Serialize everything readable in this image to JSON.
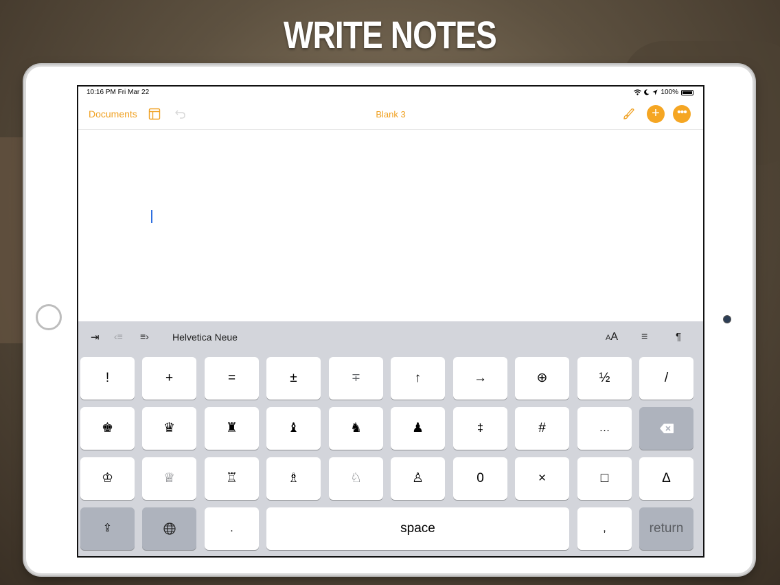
{
  "headline": "WRITE NOTES",
  "status": {
    "time_date": "10:16 PM   Fri Mar 22",
    "battery": "100%",
    "icons": [
      "wifi-icon",
      "moon-icon",
      "location-arrow-icon",
      "battery-icon"
    ]
  },
  "nav": {
    "documents_label": "Documents",
    "title": "Blank 3",
    "plus": "+",
    "more": "•••",
    "icons": [
      "sidebar-icon",
      "undo-icon",
      "brush-icon",
      "plus-icon",
      "more-icon"
    ]
  },
  "toolbar": {
    "indent": "⇥",
    "outdent": "‹≡",
    "indent_list": "≡›",
    "font": "Helvetica Neue",
    "text_size": "AA",
    "align": "≡",
    "pilcrow": "¶"
  },
  "keys": {
    "row1": [
      "!",
      "+",
      "=",
      "±",
      "∓",
      "↑",
      "→",
      "⊕",
      "½",
      "/"
    ],
    "row2": [
      "♚",
      "♛",
      "♜",
      "♝",
      "♞",
      "♟",
      "‡",
      "#",
      "…"
    ],
    "row3": [
      "♔",
      "♕",
      "♖",
      "♗",
      "♘",
      "♙",
      "0",
      "×",
      "□",
      "Δ"
    ],
    "delete": "⌫",
    "shift": "⇪",
    "globe": "◎",
    "period": ".",
    "space": "space",
    "comma": ",",
    "return": "return"
  },
  "colors": {
    "accent": "#f0a020",
    "keyboard_bg": "#d3d5db",
    "key_bg": "#ffffff",
    "key_gray": "#aeb3bd",
    "caret": "#2f6fe0"
  }
}
